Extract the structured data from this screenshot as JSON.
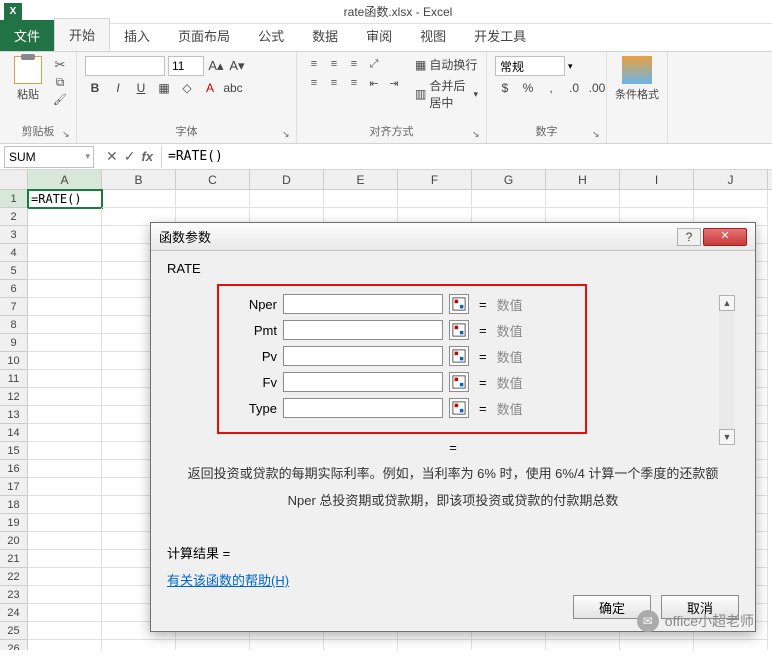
{
  "title_bar": {
    "doc_title": "rate函数.xlsx - Excel"
  },
  "tabs": {
    "file": "文件",
    "home": "开始",
    "insert": "插入",
    "layout": "页面布局",
    "formula": "公式",
    "data": "数据",
    "review": "审阅",
    "view": "视图",
    "dev": "开发工具"
  },
  "ribbon": {
    "clipboard": {
      "paste": "粘贴",
      "label": "剪贴板"
    },
    "font": {
      "label": "字体",
      "size": "11"
    },
    "align": {
      "wrap": "自动换行",
      "merge": "合并后居中",
      "label": "对齐方式"
    },
    "number": {
      "general": "常规",
      "label": "数字"
    },
    "styles": {
      "cond": "条件格式"
    }
  },
  "namebox": "SUM",
  "formula": "=RATE()",
  "cellA1": "=RATE()",
  "columns": [
    "A",
    "B",
    "C",
    "D",
    "E",
    "F",
    "G",
    "H",
    "I",
    "J"
  ],
  "dialog": {
    "title": "函数参数",
    "fn": "RATE",
    "params": [
      {
        "label": "Nper",
        "ph": "数值"
      },
      {
        "label": "Pmt",
        "ph": "数值"
      },
      {
        "label": "Pv",
        "ph": "数值"
      },
      {
        "label": "Fv",
        "ph": "数值"
      },
      {
        "label": "Type",
        "ph": "数值"
      }
    ],
    "eq": "=",
    "mid_eq": "=",
    "desc": "返回投资或贷款的每期实际利率。例如，当利率为 6% 时，使用 6%/4 计算一个季度的还款额",
    "desc2": "Nper  总投资期或贷款期，即该项投资或贷款的付款期总数",
    "calc": "计算结果 =",
    "help": "有关该函数的帮助(H)",
    "ok": "确定",
    "cancel": "取消"
  },
  "watermark": "office小超老师"
}
